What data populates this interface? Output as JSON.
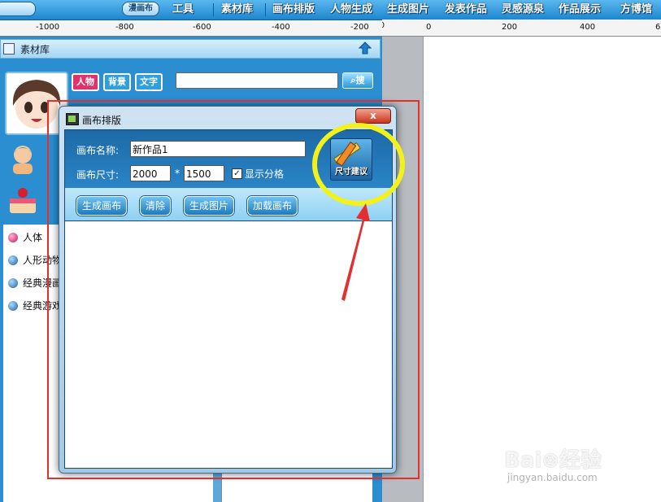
{
  "topbar": {
    "left_pill": "...",
    "pill_label": "漫画布",
    "menu": [
      "工具",
      "素材库",
      "画布排版",
      "人物生成",
      "生成图片",
      "发表作品",
      "灵感源泉",
      "作品展示",
      "方博馆"
    ]
  },
  "ruler": {
    "labels": [
      "-1000",
      "-800",
      "-600",
      "-400",
      "-200",
      "0",
      "200",
      "400",
      "6"
    ]
  },
  "panel": {
    "title": "素材库",
    "categories": [
      "人物",
      "背景",
      "文字"
    ],
    "search_value": "",
    "search_button": "搜",
    "tree": [
      "人体",
      "人形动物",
      "经典漫画",
      "经典游戏"
    ]
  },
  "dialog": {
    "title": "画布排版",
    "close_label": "x",
    "name_label": "画布名称:",
    "name_value": "新作品1",
    "size_label": "画布尺寸:",
    "width_value": "2000",
    "times": "*",
    "height_value": "1500",
    "show_grid_label": "显示分格",
    "show_grid_checked": "✓",
    "size_suggest_label": "尺寸建议",
    "buttons": [
      "生成画布",
      "清除",
      "生成图片",
      "加载画布"
    ]
  },
  "watermark": {
    "main": "Bai⊛经验",
    "sub": "jingyan.baidu.com"
  },
  "colors": {
    "menu_blue": "#1d86cf",
    "annotation_red": "#e23030",
    "annotation_yellow": "#f2f21a"
  }
}
